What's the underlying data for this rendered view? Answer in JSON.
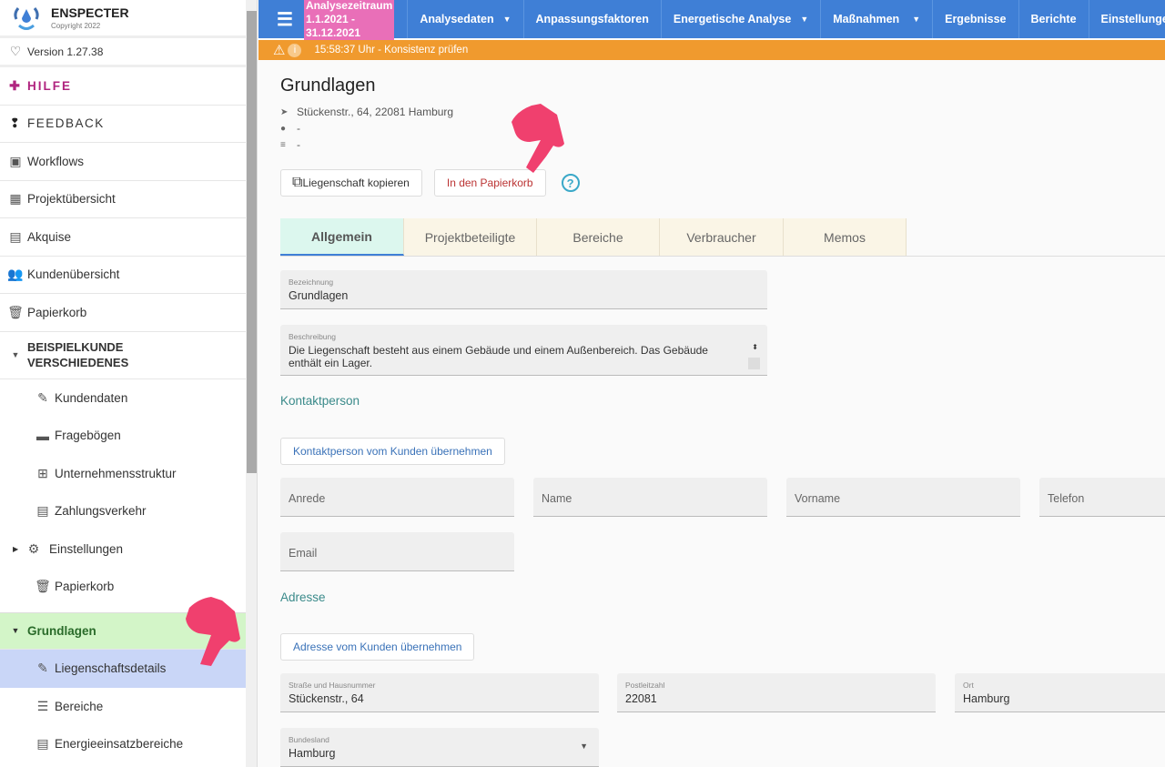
{
  "sidebar": {
    "app_name": "ENSPECTER",
    "copyright": "Copyright 2022",
    "version": "Version 1.27.38",
    "help": "HILFE",
    "feedback": "FEEDBACK",
    "items": [
      "Workflows",
      "Projektübersicht",
      "Akquise",
      "Kundenübersicht",
      "Papierkorb"
    ],
    "customer": "BEISPIELKUNDE VERSCHIEDENES",
    "customer_items": [
      "Kundendaten",
      "Fragebögen",
      "Unternehmensstruktur",
      "Zahlungsverkehr",
      "Einstellungen",
      "Papierkorb"
    ],
    "property": "Grundlagen",
    "property_items": [
      "Liegenschaftsdetails",
      "Bereiche",
      "Energieeinsatzbereiche"
    ]
  },
  "topbar": {
    "period_label": "Analysezeitraum",
    "period_value": "1.1.2021 - 31.12.2021",
    "nav": [
      "Analysedaten",
      "Anpassungsfaktoren",
      "Energetische Analyse",
      "Maßnahmen",
      "Ergebnisse",
      "Berichte",
      "Einstellungen"
    ]
  },
  "alert": {
    "text": "15:58:37 Uhr - Konsistenz prüfen"
  },
  "main": {
    "title": "Grundlagen",
    "address": "Stückenstr., 64, 22081 Hamburg",
    "person": "-",
    "notes": "-",
    "copy_button": "Liegenschaft kopieren",
    "trash_button": "In den Papierkorb",
    "help_icon": "?",
    "tabs": [
      "Allgemein",
      "Projektbeteiligte",
      "Bereiche",
      "Verbraucher",
      "Memos"
    ],
    "bezeichnung_label": "Bezeichnung",
    "bezeichnung": "Grundlagen",
    "beschreibung_label": "Beschreibung",
    "beschreibung": "Die Liegenschaft besteht aus einem Gebäude und einem Außenbereich. Das Gebäude enthält ein Lager.",
    "contact_section": "Kontaktperson",
    "contact_button": "Kontaktperson vom Kunden übernehmen",
    "contact_fields": [
      "Anrede",
      "Name",
      "Vorname",
      "Telefon",
      "Email"
    ],
    "address_section": "Adresse",
    "address_button": "Adresse vom Kunden übernehmen",
    "street_label": "Straße und Hausnummer",
    "street": "Stückenstr., 64",
    "zip_label": "Postleitzahl",
    "zip": "22081",
    "city_label": "Ort",
    "city": "Hamburg",
    "state_label": "Bundesland",
    "state": "Hamburg"
  },
  "colors": {
    "topbar": "#3f7fd6",
    "alert": "#f09a2e",
    "period": "#e96fb8",
    "help": "#b0247f",
    "active_property": "#d3f5c8",
    "active_item": "#c9d6f7"
  }
}
